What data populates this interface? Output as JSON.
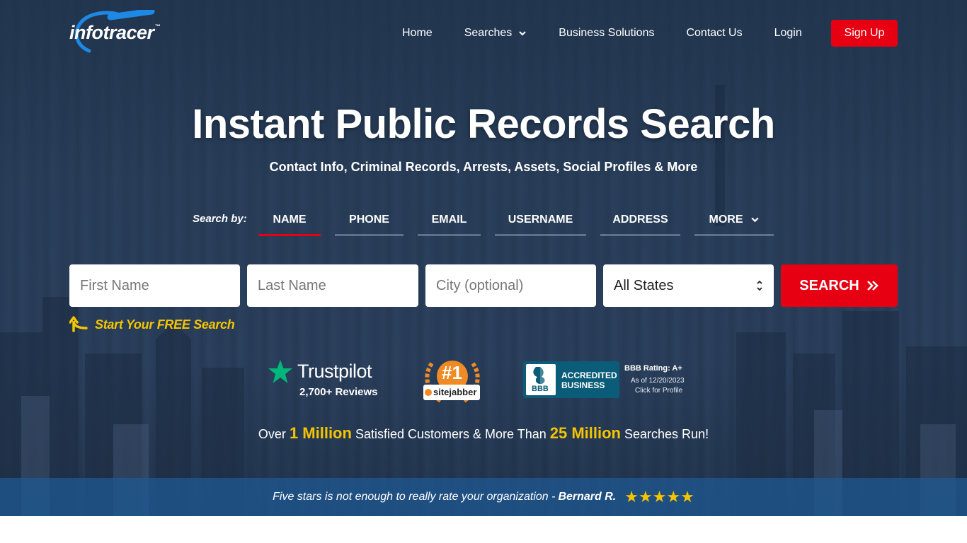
{
  "brand": {
    "logo_text": "infotracer",
    "logo_tm": "™"
  },
  "nav": {
    "items": [
      {
        "label": "Home",
        "has_dropdown": false
      },
      {
        "label": "Searches",
        "has_dropdown": true
      },
      {
        "label": "Business Solutions",
        "has_dropdown": false
      },
      {
        "label": "Contact Us",
        "has_dropdown": false
      },
      {
        "label": "Login",
        "has_dropdown": false
      }
    ],
    "signup_label": "Sign Up"
  },
  "hero": {
    "title": "Instant Public Records Search",
    "subtitle": "Contact Info, Criminal Records, Arrests, Assets, Social Profiles & More"
  },
  "search": {
    "search_by_label": "Search by:",
    "tabs": [
      {
        "label": "NAME",
        "active": true
      },
      {
        "label": "PHONE",
        "active": false
      },
      {
        "label": "EMAIL",
        "active": false
      },
      {
        "label": "USERNAME",
        "active": false
      },
      {
        "label": "ADDRESS",
        "active": false
      },
      {
        "label": "MORE",
        "active": false
      }
    ],
    "first_name_placeholder": "First Name",
    "last_name_placeholder": "Last Name",
    "city_placeholder": "City (optional)",
    "state_selected": "All States",
    "button_label": "SEARCH",
    "free_search_label": "Start Your FREE Search"
  },
  "trust": {
    "trustpilot_name": "Trustpilot",
    "trustpilot_reviews": "2,700+ Reviews",
    "sitejabber_rank": "#1",
    "sitejabber_name": "sitejabber",
    "bbb_accredited_line1": "ACCREDITED",
    "bbb_accredited_line2": "BUSINESS",
    "bbb_seal_text": "BBB",
    "bbb_rating": "BBB Rating: A+",
    "bbb_asof": "As of 12/20/2023",
    "bbb_click": "Click for Profile"
  },
  "stats": {
    "prefix": "Over",
    "customers": "1 Million",
    "middle": "Satisfied Customers & More Than",
    "searches": "25 Million",
    "suffix": "Searches Run!"
  },
  "testimonial": {
    "quote": "Five stars is not enough to really rate your organization -",
    "author": "Bernard R.",
    "stars": "★★★★★",
    "rating": 5
  },
  "colors": {
    "accent_red": "#e60012",
    "highlight_yellow": "#f5c400",
    "band_blue": "#1e5a96"
  }
}
